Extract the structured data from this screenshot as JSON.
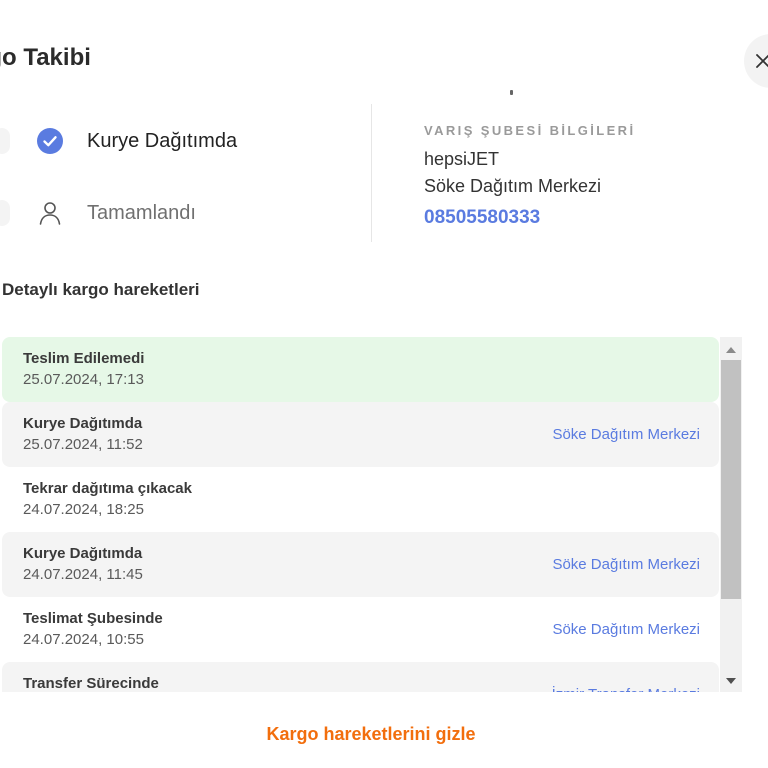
{
  "modal": {
    "title": "rgo Takibi"
  },
  "steps": [
    {
      "label": "Kurye Dağıtımda",
      "state": "completed",
      "icon": "check-circle-icon"
    },
    {
      "label": "Tamamlandı",
      "state": "pending",
      "icon": "user-icon"
    }
  ],
  "branch": {
    "title": "VARIŞ ŞUBESİ BİLGİLERİ",
    "company": "hepsiJET",
    "name": "Söke Dağıtım Merkezi",
    "phone": "08505580333"
  },
  "movements": {
    "title": "Detaylı kargo hareketleri",
    "rows": [
      {
        "status": "Teslim Edilemedi",
        "date": "25.07.2024, 17:13",
        "location": "",
        "tint": "green"
      },
      {
        "status": "Kurye Dağıtımda",
        "date": "25.07.2024, 11:52",
        "location": "Söke Dağıtım Merkezi",
        "tint": "grey"
      },
      {
        "status": "Tekrar dağıtıma çıkacak",
        "date": "24.07.2024, 18:25",
        "location": "",
        "tint": "none"
      },
      {
        "status": "Kurye Dağıtımda",
        "date": "24.07.2024, 11:45",
        "location": "Söke Dağıtım Merkezi",
        "tint": "grey"
      },
      {
        "status": "Teslimat Şubesinde",
        "date": "24.07.2024, 10:55",
        "location": "Söke Dağıtım Merkezi",
        "tint": "none"
      },
      {
        "status": "Transfer Sürecinde",
        "date": "",
        "location": "İzmir Transfer Merkezi",
        "tint": "grey"
      }
    ]
  },
  "toggle": {
    "label": "Kargo hareketlerini gizle"
  },
  "colors": {
    "accent_blue": "#5a7be0",
    "accent_orange": "#f26e0d",
    "success_bg": "#e6f8e7"
  }
}
